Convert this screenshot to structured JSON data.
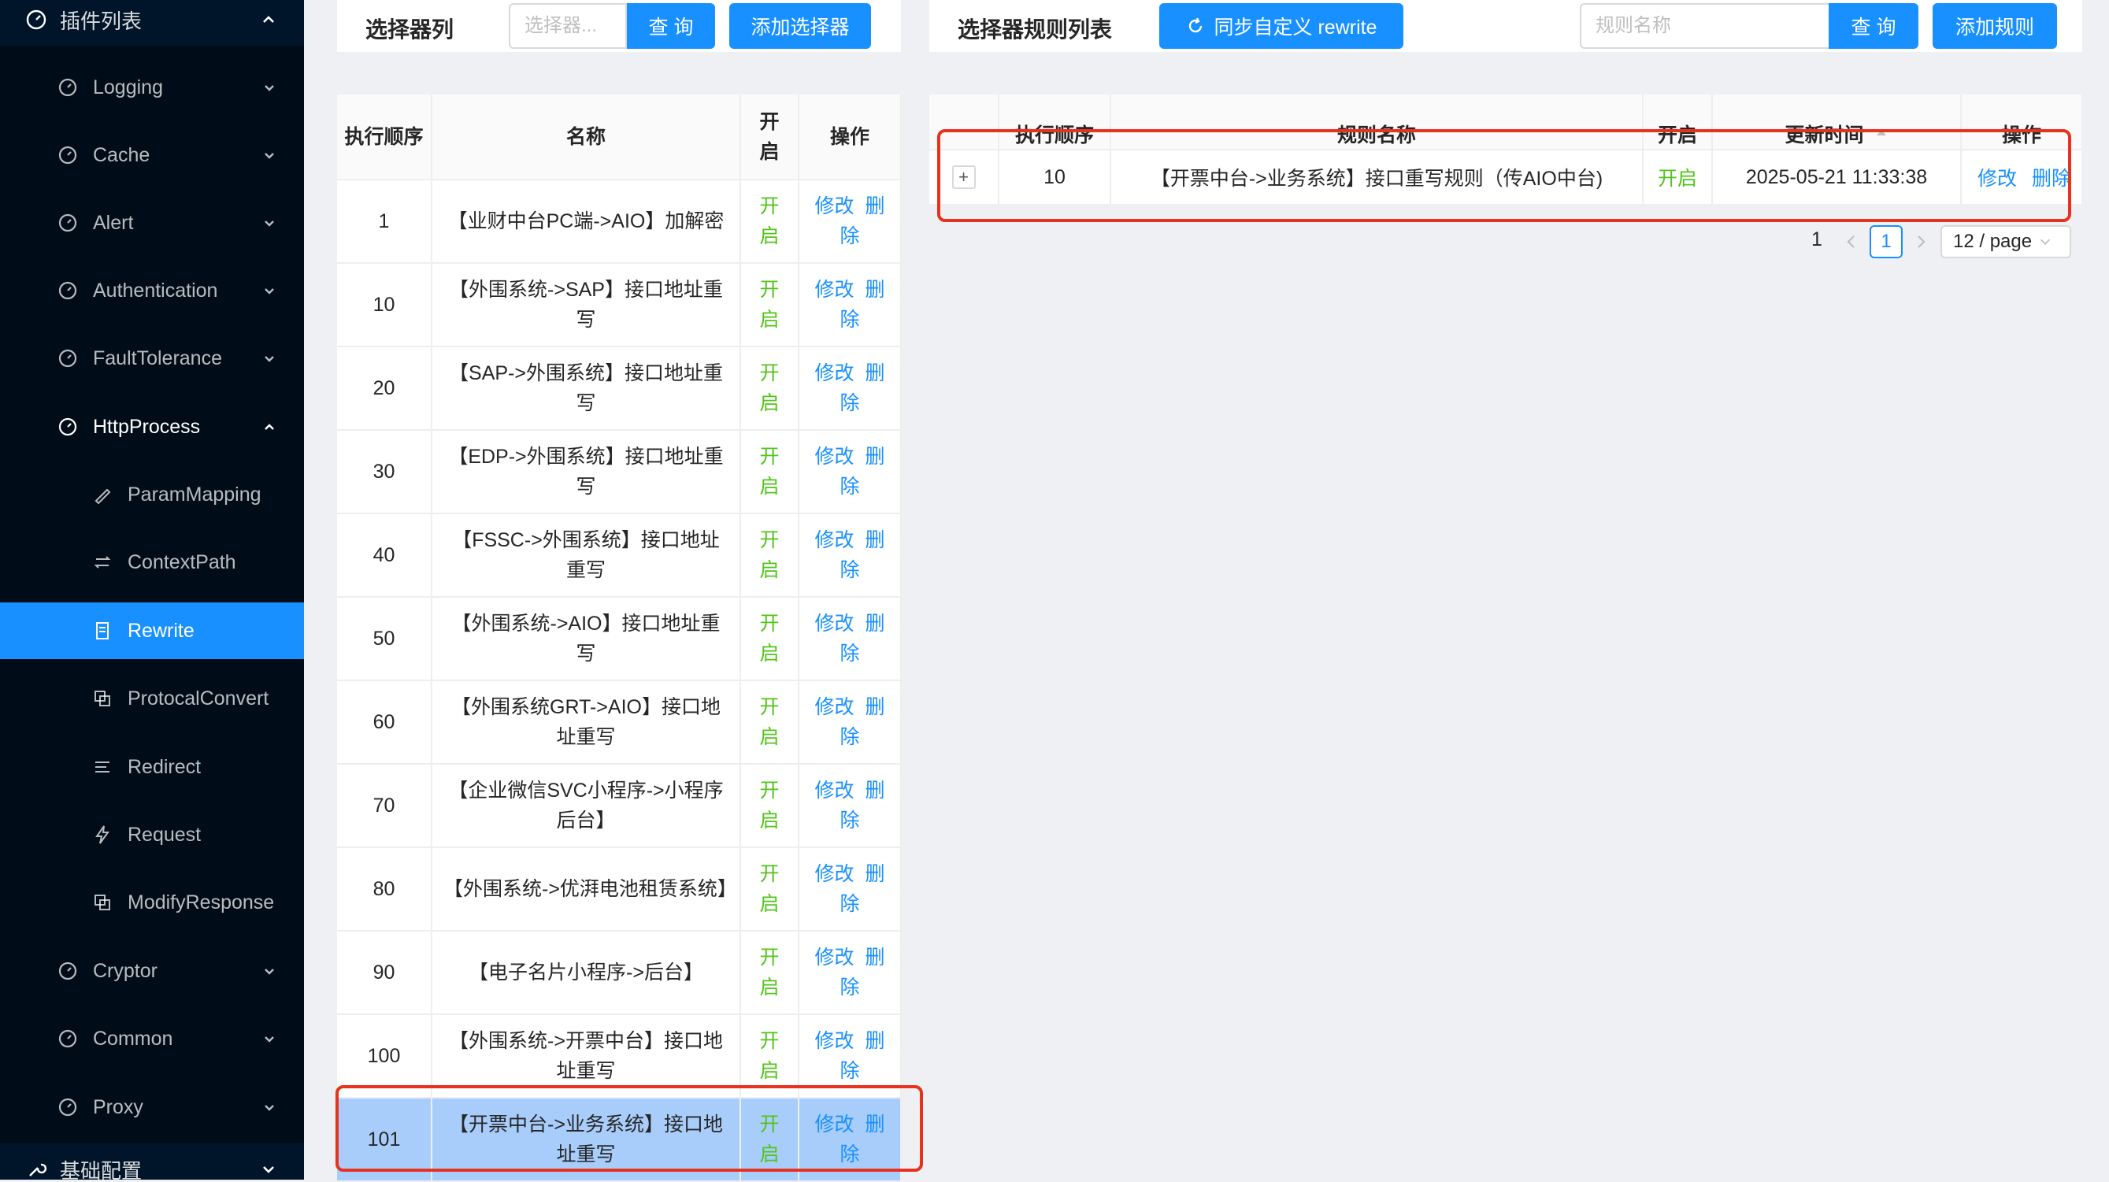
{
  "sidebar": {
    "top_group": "插件列表",
    "groups": [
      {
        "label": "Logging"
      },
      {
        "label": "Cache"
      },
      {
        "label": "Alert"
      },
      {
        "label": "Authentication"
      },
      {
        "label": "FaultTolerance"
      },
      {
        "label": "HttpProcess"
      },
      {
        "label": "Cryptor"
      },
      {
        "label": "Common"
      },
      {
        "label": "Proxy"
      }
    ],
    "http_process_items": [
      {
        "label": "ParamMapping",
        "icon": "brush-icon"
      },
      {
        "label": "ContextPath",
        "icon": "swap-icon"
      },
      {
        "label": "Rewrite",
        "icon": "document-icon",
        "active": true
      },
      {
        "label": "ProtocalConvert",
        "icon": "copy-icon"
      },
      {
        "label": "Redirect",
        "icon": "list-icon"
      },
      {
        "label": "Request",
        "icon": "lightning-icon"
      },
      {
        "label": "ModifyResponse",
        "icon": "copy-icon"
      }
    ],
    "bottom_group": "基础配置"
  },
  "selector_panel": {
    "title": "选择器列",
    "search_placeholder": "选择器...",
    "query_label": "查 询",
    "add_label": "添加选择器"
  },
  "selector_table": {
    "headers": [
      "执行顺序",
      "名称",
      "开启",
      "操作"
    ],
    "rows": [
      {
        "order": "1",
        "name": "【业财中台PC端->AIO】加解密",
        "enabled": "开启",
        "edit": "修改",
        "delete": "删除"
      },
      {
        "order": "10",
        "name": "【外围系统->SAP】接口地址重写",
        "enabled": "开启",
        "edit": "修改",
        "delete": "删除"
      },
      {
        "order": "20",
        "name": "【SAP->外围系统】接口地址重写",
        "enabled": "开启",
        "edit": "修改",
        "delete": "删除"
      },
      {
        "order": "30",
        "name": "【EDP->外围系统】接口地址重写",
        "enabled": "开启",
        "edit": "修改",
        "delete": "删除"
      },
      {
        "order": "40",
        "name": "【FSSC->外围系统】接口地址重写",
        "enabled": "开启",
        "edit": "修改",
        "delete": "删除"
      },
      {
        "order": "50",
        "name": "【外围系统->AIO】接口地址重写",
        "enabled": "开启",
        "edit": "修改",
        "delete": "删除"
      },
      {
        "order": "60",
        "name": "【外围系统GRT->AIO】接口地址重写",
        "enabled": "开启",
        "edit": "修改",
        "delete": "删除"
      },
      {
        "order": "70",
        "name": "【企业微信SVC小程序->小程序后台】",
        "enabled": "开启",
        "edit": "修改",
        "delete": "删除"
      },
      {
        "order": "80",
        "name": "【外围系统->优湃电池租赁系统】",
        "enabled": "开启",
        "edit": "修改",
        "delete": "删除"
      },
      {
        "order": "90",
        "name": "【电子名片小程序->后台】",
        "enabled": "开启",
        "edit": "修改",
        "delete": "删除"
      },
      {
        "order": "100",
        "name": "【外围系统->开票中台】接口地址重写",
        "enabled": "开启",
        "edit": "修改",
        "delete": "删除"
      },
      {
        "order": "101",
        "name": "【开票中台->业务系统】接口地址重写",
        "enabled": "开启",
        "edit": "修改",
        "delete": "删除",
        "selected": true
      }
    ]
  },
  "rule_panel": {
    "title": "选择器规则列表",
    "sync_label": "同步自定义 rewrite",
    "search_placeholder": "规则名称",
    "query_label": "查 询",
    "add_label": "添加规则"
  },
  "rule_table": {
    "headers": [
      "执行顺序",
      "规则名称",
      "开启",
      "更新时间",
      "操作"
    ],
    "rows": [
      {
        "expand": "+",
        "order": "10",
        "name": "【开票中台->业务系统】接口重写规则（传AIO中台)",
        "enabled": "开启",
        "updated": "2025-05-21 11:33:38",
        "edit": "修改",
        "delete": "删除"
      }
    ]
  },
  "pagination": {
    "total_pages": "1",
    "current_page": "1",
    "page_size": "12 / page"
  },
  "colors": {
    "sidebar_bg": "#001529",
    "accent": "#1890ff",
    "enabled_green": "#52c41a",
    "highlight_red": "#e8321f",
    "selected_row": "#a8cdfb"
  }
}
